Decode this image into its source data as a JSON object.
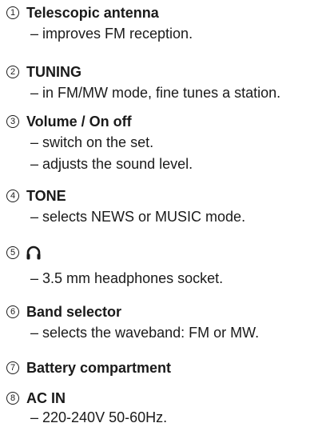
{
  "items": [
    {
      "number": "1",
      "title": "Telescopic antenna",
      "lines": [
        "– improves FM reception."
      ]
    },
    {
      "number": "2",
      "title": "TUNING",
      "lines": [
        "– in FM/MW mode, fine tunes a station."
      ]
    },
    {
      "number": "3",
      "title": "Volume / On off",
      "lines": [
        "– switch on the set.",
        "– adjusts the sound level."
      ]
    },
    {
      "number": "4",
      "title": "TONE",
      "lines": [
        "– selects NEWS or MUSIC mode."
      ]
    },
    {
      "number": "5",
      "icon": "headphones-icon",
      "lines": [
        "– 3.5 mm headphones socket."
      ]
    },
    {
      "number": "6",
      "title": "Band selector",
      "lines": [
        "– selects the waveband: FM or MW."
      ]
    },
    {
      "number": "7",
      "title": "Battery compartment",
      "lines": []
    },
    {
      "number": "8",
      "title": "AC IN",
      "lines": [
        "– 220-240V  50-60Hz."
      ]
    }
  ]
}
